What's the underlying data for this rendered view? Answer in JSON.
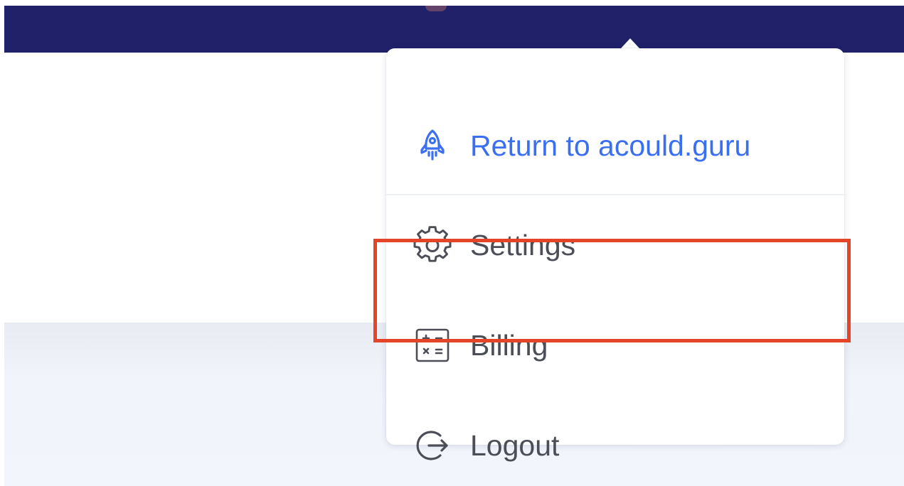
{
  "header": {
    "background_color": "#21216a"
  },
  "dropdown": {
    "items": [
      {
        "label": "Return to acould.guru",
        "icon": "rocket-icon",
        "color": "#3b6ff2"
      },
      {
        "label": "Settings",
        "icon": "gear-icon",
        "color": "#4b4e57"
      },
      {
        "label": "Billing",
        "icon": "calculator-icon",
        "color": "#4b4e57"
      },
      {
        "label": "Logout",
        "icon": "logout-icon",
        "color": "#4b4e57"
      }
    ]
  },
  "annotation": {
    "highlight_color": "#e44528",
    "highlighted_item": "Billing"
  }
}
